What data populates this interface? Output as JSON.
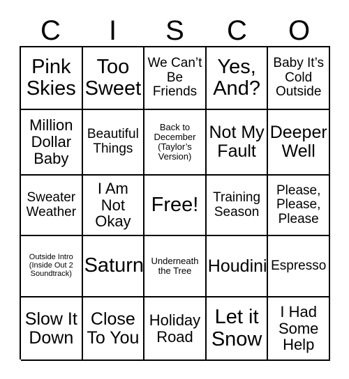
{
  "card": {
    "header_letters": [
      "C",
      "I",
      "S",
      "C",
      "O"
    ],
    "rows": [
      [
        {
          "text": "Pink Skies",
          "size": "xxl"
        },
        {
          "text": "Too Sweet",
          "size": "xxl"
        },
        {
          "text": "We Can’t Be Friends",
          "size": "m"
        },
        {
          "text": "Yes, And?",
          "size": "xxl"
        },
        {
          "text": "Baby It’s Cold Outside",
          "size": "m"
        }
      ],
      [
        {
          "text": "Million Dollar Baby",
          "size": "l"
        },
        {
          "text": "Beautiful Things",
          "size": "m"
        },
        {
          "text": "Back to December (Taylor’s Version)",
          "size": "xs"
        },
        {
          "text": "Not My Fault",
          "size": "xl"
        },
        {
          "text": "Deeper Well",
          "size": "xl"
        }
      ],
      [
        {
          "text": "Sweater Weather",
          "size": "m"
        },
        {
          "text": "I Am Not Okay",
          "size": "l"
        },
        {
          "text": "Free!",
          "size": "xxl"
        },
        {
          "text": "Training Season",
          "size": "m"
        },
        {
          "text": "Please, Please, Please",
          "size": "m"
        }
      ],
      [
        {
          "text": "Outside Intro (Inside Out 2 Soundtrack)",
          "size": "xxs"
        },
        {
          "text": "Saturn",
          "size": "xxl"
        },
        {
          "text": "Underneath the Tree",
          "size": "xs"
        },
        {
          "text": "Houdini",
          "size": "xl"
        },
        {
          "text": "Espresso",
          "size": "m"
        }
      ],
      [
        {
          "text": "Slow It Down",
          "size": "xl"
        },
        {
          "text": "Close To You",
          "size": "xl"
        },
        {
          "text": "Holiday Road",
          "size": "l"
        },
        {
          "text": "Let it Snow",
          "size": "xxl"
        },
        {
          "text": "I Had Some Help",
          "size": "l"
        }
      ]
    ]
  },
  "colors": {
    "background": "#ffffff",
    "text": "#000000",
    "grid_line": "#000000"
  }
}
